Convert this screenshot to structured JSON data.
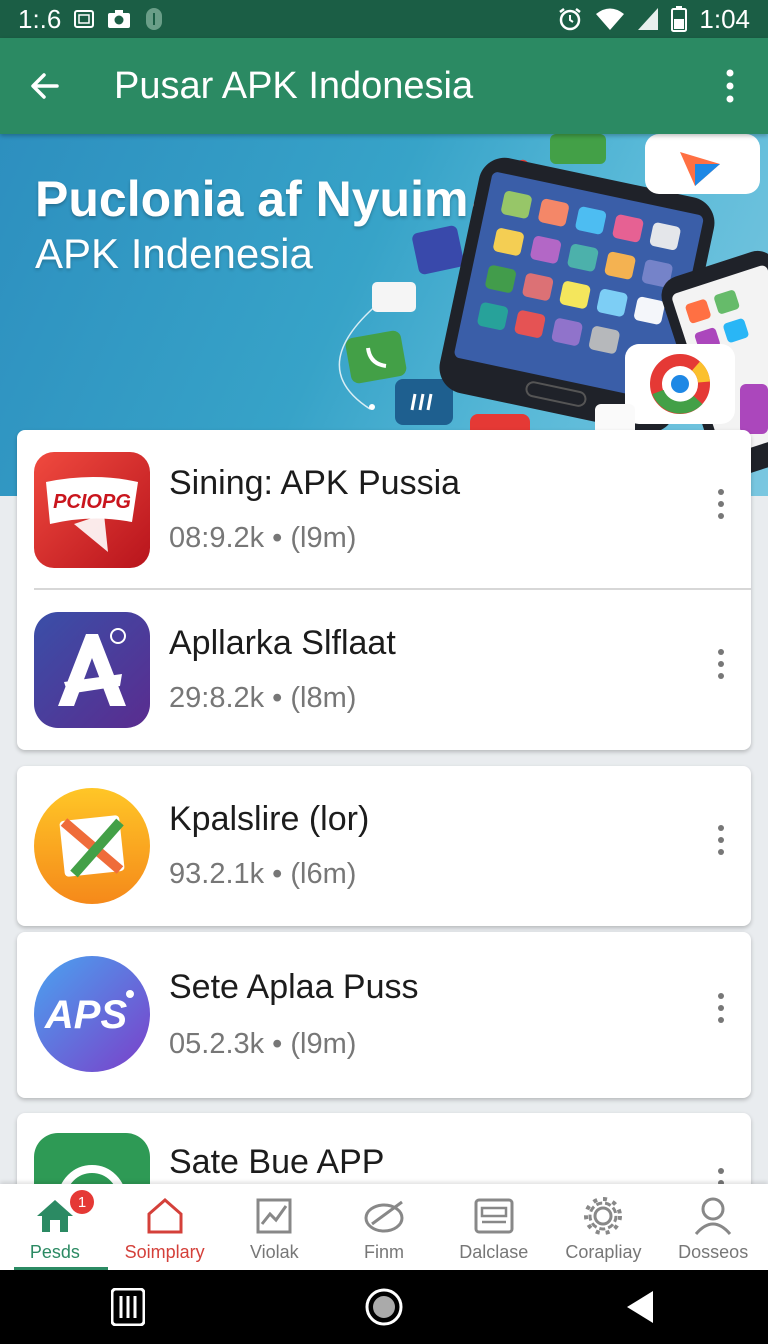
{
  "status_bar": {
    "time_left": "1:.6",
    "time_right": "1:04",
    "icons_left": [
      "sim-icon",
      "camera-icon",
      "shield-icon"
    ],
    "icons_right": [
      "alarm-icon",
      "wifi-icon",
      "signal-icon",
      "battery-icon"
    ]
  },
  "app_bar": {
    "title": "Pusar APK Indonesia",
    "back_icon": "arrow-left-icon",
    "menu_icon": "more-vert-icon"
  },
  "hero": {
    "headline": "Puclonia af Nyuim",
    "subline": "APK Indenesia"
  },
  "apps": [
    {
      "name": "Sining: APK Pussia",
      "meta": "08:9.2k • (l9m)",
      "icon": "red-ribbon-app-icon"
    },
    {
      "name": "Apllarka Slflaat",
      "meta": "29:8.2k • (l8m)",
      "icon": "letter-a-app-icon"
    },
    {
      "name": "Kpalslire (lor)",
      "meta": "93.2.1k • (l6m)",
      "icon": "envelope-app-icon"
    },
    {
      "name": "Sete Aplaa Puss",
      "meta": "05.2.3k • (l9m)",
      "icon": "aps-app-icon"
    },
    {
      "name": "Sate Bue APP",
      "meta": "",
      "icon": "green-robot-app-icon"
    }
  ],
  "bottom_nav": [
    {
      "label": "Pesds",
      "icon": "home-icon",
      "badge": "1",
      "active": true
    },
    {
      "label": "Soimplary",
      "icon": "house-outline-icon"
    },
    {
      "label": "Violak",
      "icon": "chart-icon"
    },
    {
      "label": "Finm",
      "icon": "tag-check-icon"
    },
    {
      "label": "Dalclase",
      "icon": "card-icon"
    },
    {
      "label": "Corapliay",
      "icon": "gear-icon"
    },
    {
      "label": "Dosseos",
      "icon": "person-icon"
    }
  ],
  "colors": {
    "primary": "#2b8a63",
    "status_bar": "#1b5e45",
    "accent_red": "#d4403a"
  }
}
